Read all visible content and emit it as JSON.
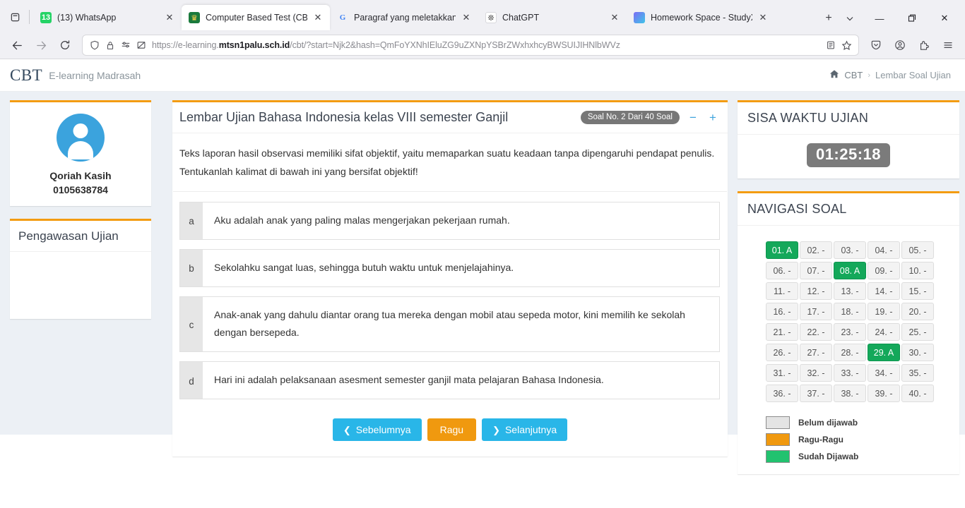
{
  "browser": {
    "tab_list_icon": "tab-list-icon",
    "tabs": [
      {
        "title": "(13) WhatsApp",
        "favicon": "whatsapp-icon",
        "active": false,
        "badge": "13"
      },
      {
        "title": "Computer Based Test (CBT)",
        "favicon": "madrasah-icon",
        "active": true
      },
      {
        "title": "Paragraf yang meletakkan ga",
        "favicon": "google-icon",
        "active": false
      },
      {
        "title": "ChatGPT",
        "favicon": "chatgpt-icon",
        "active": false
      },
      {
        "title": "Homework Space - StudyX",
        "favicon": "studyx-icon",
        "active": false
      }
    ],
    "new_tab_label": "+",
    "tab_dropdown_label": "∨",
    "window_controls": {
      "minimize": "—",
      "maximize": "❐",
      "close": "✕"
    },
    "nav": {
      "back": "←",
      "forward": "→",
      "reload": "⟳"
    },
    "url": {
      "prefix": "https://e-learning.",
      "host": "mtsn1palu.sch.id",
      "suffix": "/cbt/?start=Njk2&hash=QmFoYXNhIEluZG9uZXNpYSBrZWxhxhcyBWSUIJIHNlbWVz",
      "shield_icon": "shield-icon",
      "lock_icon": "lock-icon",
      "permissions_icon": "permissions-icon",
      "tracking_icon": "tracking-protection-icon",
      "reader_icon": "reader-view-icon",
      "bookmark_icon": "bookmark-star-icon"
    },
    "toolbar_icons": [
      "save-to-pocket-icon",
      "account-icon",
      "extensions-icon",
      "app-menu-icon"
    ]
  },
  "header": {
    "logo": "CBT",
    "logo_sub": "E-learning Madrasah",
    "breadcrumb": {
      "home_icon": "home-icon",
      "root": "CBT",
      "separator": "›",
      "current": "Lembar Soal Ujian"
    }
  },
  "sidebar_left": {
    "profile": {
      "avatar_icon": "user-avatar-icon",
      "name": "Qoriah Kasih",
      "id": "0105638784"
    },
    "pengawasan": {
      "title": "Pengawasan Ujian"
    }
  },
  "exam": {
    "title": "Lembar Ujian Bahasa Indonesia kelas VIII semester Ganjil",
    "badge": "Soal No. 2 Dari 40 Soal",
    "zoom_out": "−",
    "zoom_in": "+",
    "question": "Teks laporan hasil observasi memiliki sifat objektif, yaitu memaparkan suatu keadaan tanpa dipengaruhi pendapat penulis. Tentukanlah kalimat di bawah ini yang bersifat objektif!",
    "options": [
      {
        "letter": "a",
        "text": "Aku adalah anak yang paling malas mengerjakan pekerjaan rumah."
      },
      {
        "letter": "b",
        "text": "Sekolahku sangat luas, sehingga butuh waktu untuk menjelajahinya."
      },
      {
        "letter": "c",
        "text": "Anak-anak yang dahulu diantar orang tua mereka dengan mobil atau sepeda motor, kini memilih ke sekolah dengan bersepeda."
      },
      {
        "letter": "d",
        "text": "Hari ini adalah pelaksanaan asesment semester ganjil mata pelajaran Bahasa Indonesia."
      }
    ],
    "actions": {
      "prev": "Sebelumnya",
      "prev_icon": "chevron-left-icon",
      "ragu": "Ragu",
      "next": "Selanjutnya",
      "next_icon": "chevron-right-icon"
    }
  },
  "sidebar_right": {
    "timer": {
      "title": "SISA WAKTU UJIAN",
      "value": "01:25:18"
    },
    "navigation": {
      "title": "NAVIGASI SOAL",
      "items": [
        {
          "label": "01. A",
          "state": "answered"
        },
        {
          "label": "02. -",
          "state": "unanswered"
        },
        {
          "label": "03. -",
          "state": "unanswered"
        },
        {
          "label": "04. -",
          "state": "unanswered"
        },
        {
          "label": "05. -",
          "state": "unanswered"
        },
        {
          "label": "06. -",
          "state": "unanswered"
        },
        {
          "label": "07. -",
          "state": "unanswered"
        },
        {
          "label": "08. A",
          "state": "answered"
        },
        {
          "label": "09. -",
          "state": "unanswered"
        },
        {
          "label": "10. -",
          "state": "unanswered"
        },
        {
          "label": "11. -",
          "state": "unanswered"
        },
        {
          "label": "12. -",
          "state": "unanswered"
        },
        {
          "label": "13. -",
          "state": "unanswered"
        },
        {
          "label": "14. -",
          "state": "unanswered"
        },
        {
          "label": "15. -",
          "state": "unanswered"
        },
        {
          "label": "16. -",
          "state": "unanswered"
        },
        {
          "label": "17. -",
          "state": "unanswered"
        },
        {
          "label": "18. -",
          "state": "unanswered"
        },
        {
          "label": "19. -",
          "state": "unanswered"
        },
        {
          "label": "20. -",
          "state": "unanswered"
        },
        {
          "label": "21. -",
          "state": "unanswered"
        },
        {
          "label": "22. -",
          "state": "unanswered"
        },
        {
          "label": "23. -",
          "state": "unanswered"
        },
        {
          "label": "24. -",
          "state": "unanswered"
        },
        {
          "label": "25. -",
          "state": "unanswered"
        },
        {
          "label": "26. -",
          "state": "unanswered"
        },
        {
          "label": "27. -",
          "state": "unanswered"
        },
        {
          "label": "28. -",
          "state": "unanswered"
        },
        {
          "label": "29. A",
          "state": "answered"
        },
        {
          "label": "30. -",
          "state": "unanswered"
        },
        {
          "label": "31. -",
          "state": "unanswered"
        },
        {
          "label": "32. -",
          "state": "unanswered"
        },
        {
          "label": "33. -",
          "state": "unanswered"
        },
        {
          "label": "34. -",
          "state": "unanswered"
        },
        {
          "label": "35. -",
          "state": "unanswered"
        },
        {
          "label": "36. -",
          "state": "unanswered"
        },
        {
          "label": "37. -",
          "state": "unanswered"
        },
        {
          "label": "38. -",
          "state": "unanswered"
        },
        {
          "label": "39. -",
          "state": "unanswered"
        },
        {
          "label": "40. -",
          "state": "unanswered"
        }
      ],
      "legend": [
        {
          "label": "Belum dijawab",
          "color": "#e4e4e4"
        },
        {
          "label": "Ragu-Ragu",
          "color": "#f0990f"
        },
        {
          "label": "Sudah Dijawab",
          "color": "#22c26f"
        }
      ]
    }
  },
  "colors": {
    "accent_orange": "#f39c12",
    "primary_blue": "#29b6e8",
    "answered_green": "#14a85a",
    "page_bg": "#ecf0f5"
  }
}
